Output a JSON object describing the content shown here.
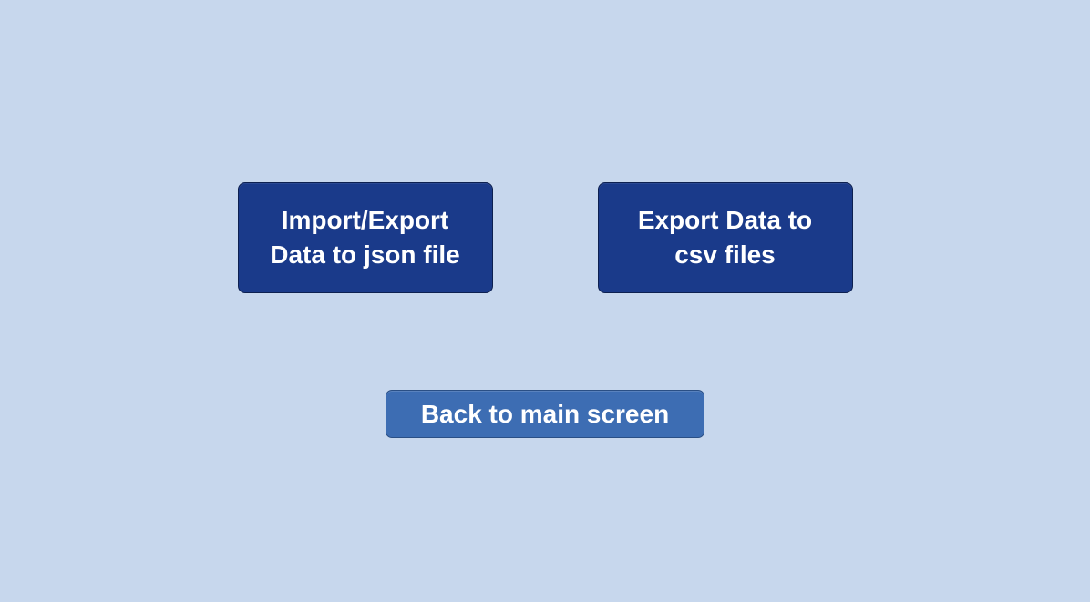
{
  "buttons": {
    "import_export_json": "Import/Export Data to json file",
    "export_csv": "Export Data to csv files",
    "back": "Back to main screen"
  }
}
